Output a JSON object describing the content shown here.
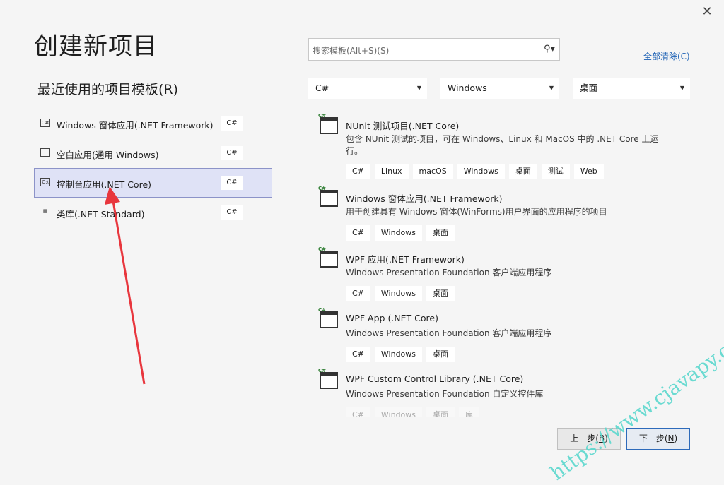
{
  "window": {
    "close_glyph": "✕",
    "title": "创建新项目"
  },
  "recent": {
    "title_prefix": "最近使用的项目模板(",
    "title_key": "R",
    "title_suffix": ")",
    "items": [
      {
        "label": "Windows 窗体应用(.NET Framework)",
        "lang": "C#",
        "icon": "winforms-icon",
        "selected": false
      },
      {
        "label": "空白应用(通用 Windows)",
        "lang": "C#",
        "icon": "uwp-icon",
        "selected": false
      },
      {
        "label": "控制台应用(.NET Core)",
        "lang": "C#",
        "icon": "console-icon",
        "selected": true
      },
      {
        "label": "类库(.NET Standard)",
        "lang": "C#",
        "icon": "class-library-icon",
        "selected": false
      }
    ]
  },
  "search": {
    "placeholder": "搜索模板(Alt+S)(S)",
    "icon": "search-icon"
  },
  "clear_all": "全部清除(C)",
  "filters": {
    "language": "C#",
    "platform": "Windows",
    "project_type": "桌面"
  },
  "templates": [
    {
      "name": "NUnit 测试项目(.NET Core)",
      "desc": "包含 NUnit 测试的项目，可在 Windows、Linux 和 MacOS 中的 .NET Core 上运行。",
      "tags": [
        "C#",
        "Linux",
        "macOS",
        "Windows",
        "桌面",
        "测试",
        "Web"
      ]
    },
    {
      "name": "Windows 窗体应用(.NET Framework)",
      "desc": "用于创建具有 Windows 窗体(WinForms)用户界面的应用程序的项目",
      "tags": [
        "C#",
        "Windows",
        "桌面"
      ]
    },
    {
      "name": "WPF 应用(.NET Framework)",
      "desc": "Windows Presentation Foundation 客户端应用程序",
      "tags": [
        "C#",
        "Windows",
        "桌面"
      ]
    },
    {
      "name": "WPF App (.NET Core)",
      "desc": "Windows Presentation Foundation 客户端应用程序",
      "tags": [
        "C#",
        "Windows",
        "桌面"
      ]
    },
    {
      "name": "WPF Custom Control Library (.NET Core)",
      "desc": "Windows Presentation Foundation 自定义控件库",
      "tags": [
        "C#",
        "Windows",
        "桌面",
        "库"
      ]
    }
  ],
  "buttons": {
    "prev_prefix": "上一步(",
    "prev_key": "B",
    "prev_suffix": ")",
    "next_prefix": "下一步(",
    "next_key": "N",
    "next_suffix": ")"
  },
  "watermark": "https://www.cjavapy.com",
  "colors": {
    "selected_bg": "#dfe2f6",
    "link": "#1a5fb4",
    "annotation_arrow": "#e8363d",
    "watermark": "#5cd8ce"
  }
}
